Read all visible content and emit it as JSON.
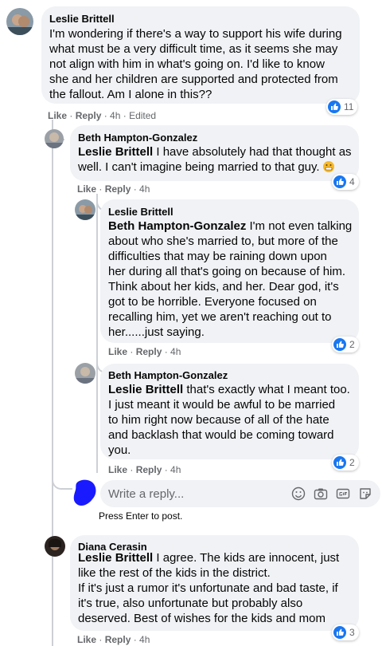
{
  "comments": [
    {
      "author": "Leslie Brittell",
      "lines": [
        "I'm wondering if there's a way to support his wife during",
        "what must be a very difficult time, as it seems she may",
        "not align with him in what's going on. I'd like to know",
        "she and her children are supported and protected from",
        "the fallout. Am I alone in this??"
      ],
      "like": "Like",
      "reply": "Reply",
      "time": "4h",
      "edited": "Edited",
      "reactions": "11"
    },
    {
      "author": "Beth Hampton-Gonzalez",
      "mention": "Leslie Brittell",
      "line1_rest": " I have absolutely had that thought as",
      "lines": [
        "well. I can't imagine being married to that guy."
      ],
      "like": "Like",
      "reply": "Reply",
      "time": "4h",
      "reactions": "4"
    },
    {
      "author": "Leslie Brittell",
      "mention": "Beth Hampton-Gonzalez",
      "line1_rest": " I'm not even talking",
      "lines": [
        "about who she's married to, but more of the",
        "difficulties that may be raining down upon",
        "her during all that's going on because of him.",
        "Think about her kids, and her. Dear god, it's",
        "got to be horrible. Everyone focused on",
        "recalling him, yet we aren't reaching out to",
        "her......just saying."
      ],
      "like": "Like",
      "reply": "Reply",
      "time": "4h",
      "reactions": "2"
    },
    {
      "author": "Beth Hampton-Gonzalez",
      "mention": "Leslie Brittell",
      "line1_rest": " that's exactly what I meant too.",
      "lines": [
        "I just meant it would be awful to be married",
        "to him right now because of all of the hate",
        "and backlash that would be coming toward",
        "you."
      ],
      "like": "Like",
      "reply": "Reply",
      "time": "4h",
      "reactions": "2"
    },
    {
      "author": "Diana Cerasin",
      "mention": "Leslie Brittell",
      "line1_rest": " I agree. The kids are innocent, just",
      "lines": [
        "like the rest of the kids in the district.",
        "If it's just a rumor it's unfortunate and bad taste, if",
        "it's true, also unfortunate but probably also",
        "deserved. Best of wishes for the kids and mom"
      ],
      "like": "Like",
      "reply": "Reply",
      "time": "4h",
      "reactions": "3"
    }
  ],
  "reply_box": {
    "placeholder": "Write a reply...",
    "hint": "Press Enter to post."
  },
  "colors": {
    "accent": "#1877f2",
    "bubble": "#f0f2f5",
    "meta": "#65676b",
    "redaction": "#1a1aff"
  },
  "icons": [
    "like-icon",
    "emoji-icon",
    "camera-icon",
    "gif-icon",
    "sticker-icon",
    "grimace-emoji-icon"
  ]
}
